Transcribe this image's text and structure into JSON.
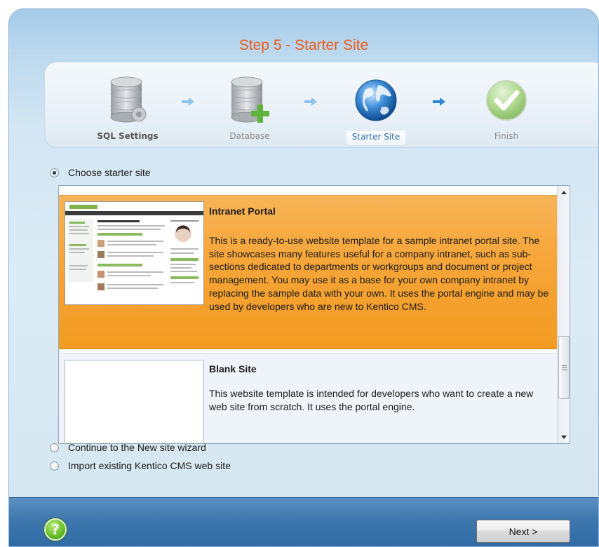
{
  "wizard": {
    "title": "Step 5 - Starter Site"
  },
  "steps": [
    {
      "label": "SQL Settings",
      "icon": "database-gear-icon",
      "state": "done"
    },
    {
      "label": "Database",
      "icon": "database-add-icon",
      "state": "done"
    },
    {
      "label": "Starter Site",
      "icon": "globe-icon",
      "state": "current"
    },
    {
      "label": "Finish",
      "icon": "checkmark-icon",
      "state": "pending"
    }
  ],
  "options": {
    "choose_starter": {
      "label": "Choose starter site",
      "checked": true
    },
    "new_site_wizard": {
      "label": "Continue to the New site wizard",
      "checked": false
    },
    "import_site": {
      "label": "Import existing Kentico CMS web site",
      "checked": false
    }
  },
  "sites": [
    {
      "name": "Intranet Portal",
      "description": "This is a ready-to-use website template for a sample intranet portal site. The site showcases many features useful for a company intranet, such as sub-sections dedicated to departments or workgroups and document or project management. You may use it as a base for your own company intranet by replacing the sample data with your own. It uses the portal engine and may be used by developers who are new to Kentico CMS.",
      "selected": true
    },
    {
      "name": "Blank Site",
      "description": "This website template is intended for developers who want to create a new web site from scratch. It uses the portal engine.",
      "selected": false
    }
  ],
  "footer": {
    "help_icon": "question-icon",
    "help_glyph": "?",
    "next_label": "Next >"
  },
  "colors": {
    "title": "#ef5b1a",
    "selected_item": "#f7a63a",
    "footer": "#3e77ad",
    "current_step": "#2e6fb0"
  }
}
